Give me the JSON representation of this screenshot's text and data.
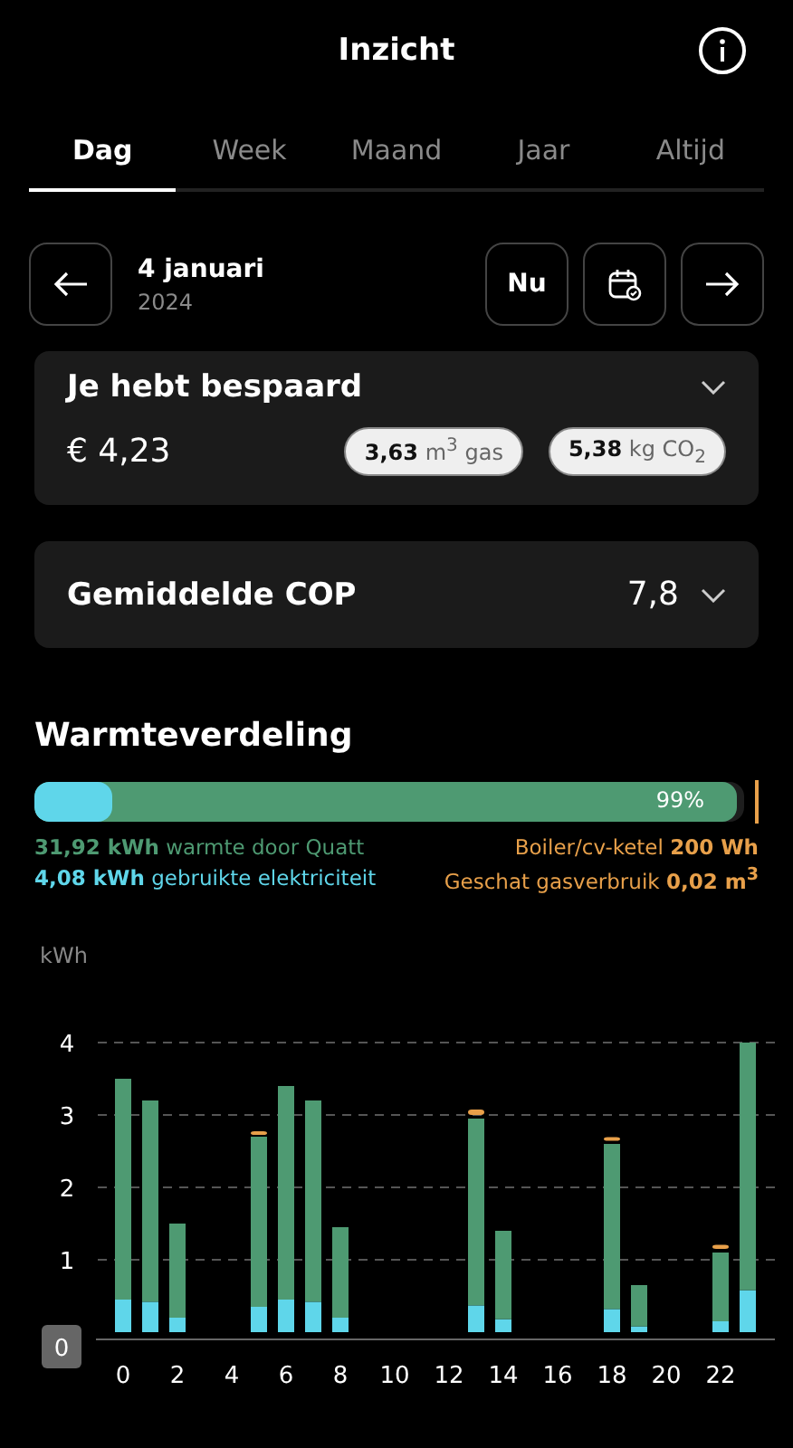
{
  "header": {
    "title": "Inzicht"
  },
  "tabs": [
    {
      "label": "Dag",
      "selected": true
    },
    {
      "label": "Week",
      "selected": false
    },
    {
      "label": "Maand",
      "selected": false
    },
    {
      "label": "Jaar",
      "selected": false
    },
    {
      "label": "Altijd",
      "selected": false
    }
  ],
  "date_nav": {
    "date": "4 januari",
    "year": "2024",
    "now_button": "Nu"
  },
  "savings_card": {
    "title": "Je hebt bespaard",
    "expanded": false,
    "amount": "€ 4,23",
    "chips": [
      {
        "value": "3,63",
        "unit": "m$^{3}$",
        "label": "gas"
      },
      {
        "value": "5,38",
        "unit": "kg",
        "label": "CO$_{2}$"
      }
    ]
  },
  "cop_card": {
    "title": "Gemiddelde COP",
    "value": "7,8",
    "expanded": false
  },
  "heat_distribution": {
    "title": "Warmteverdeling",
    "percent": "99%",
    "fills": [
      {
        "color": "#4e9a72",
        "level": 0.99
      },
      {
        "color": "#5fd6ea",
        "level": 0.11
      }
    ],
    "legend_left": [
      {
        "value": "31,92 kWh",
        "label": "warmte door Quatt",
        "color": "#4e9a72"
      },
      {
        "value": "4,08 kWh",
        "label": "gebruikte elektriciteit",
        "color": "#5fd6ea"
      }
    ],
    "legend_right": [
      {
        "label": "Boiler/cv-ketel",
        "value": "200 Wh",
        "color": "#e8a04a"
      },
      {
        "label": "Geschat gasverbruik",
        "value": "0,02 m$^{3}$",
        "color": "#e8a04a"
      }
    ]
  },
  "chart_data": {
    "type": "bar",
    "stacked": true,
    "grid": true,
    "ylabel": "kWh",
    "x": [
      0,
      1,
      2,
      3,
      4,
      5,
      6,
      7,
      8,
      9,
      10,
      11,
      12,
      13,
      14,
      15,
      16,
      17,
      18,
      19,
      20,
      21,
      22,
      23
    ],
    "series": [
      {
        "color": "#5fd6ea",
        "values": [
          0.45,
          0.42,
          0.2,
          0,
          0,
          0.35,
          0.45,
          0.42,
          0.2,
          0,
          0,
          0,
          0,
          0.37,
          0.18,
          0,
          0,
          0,
          0.32,
          0.08,
          0,
          0,
          0.15,
          0.58
        ]
      },
      {
        "color": "#4e9a72",
        "values": [
          3.05,
          2.78,
          1.3,
          0,
          0,
          2.35,
          2.95,
          2.78,
          1.25,
          0,
          0,
          0,
          0,
          2.58,
          1.22,
          0,
          0,
          0,
          2.28,
          0.57,
          0,
          0,
          0.95,
          3.42
        ]
      },
      {
        "color": "#e8a04a",
        "values": [
          0,
          0,
          0,
          0,
          0,
          0.05,
          0,
          0,
          0,
          0,
          0,
          0,
          0,
          0.1,
          0,
          0,
          0,
          0,
          0.07,
          0,
          0,
          0,
          0.08,
          0
        ]
      }
    ],
    "xlim": [
      -1,
      24
    ],
    "ylim": [
      0,
      4
    ],
    "yticks": [
      0,
      1,
      2,
      3,
      4
    ],
    "xticks": [
      0,
      2,
      4,
      6,
      8,
      10,
      12,
      14,
      16,
      18,
      20,
      22
    ]
  }
}
